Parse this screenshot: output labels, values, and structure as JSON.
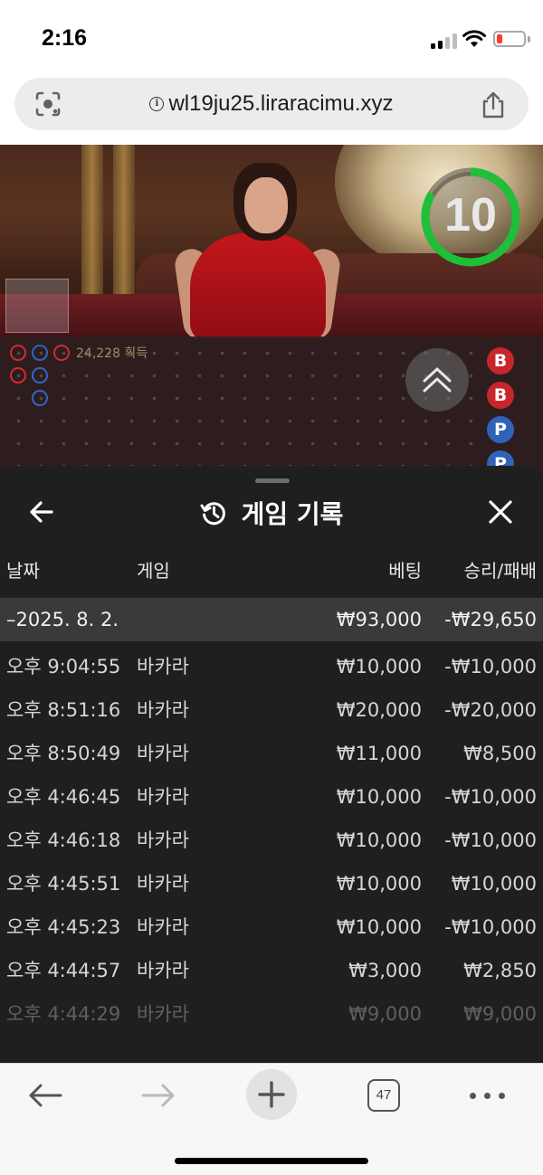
{
  "status_bar": {
    "time": "2:16"
  },
  "browser": {
    "url": "wl19ju25.liraracimu.xyz",
    "tab_count": "47"
  },
  "game": {
    "timer": "10",
    "roadmap_text": "24,228 획득",
    "side_badges": [
      "B",
      "B",
      "P",
      "P"
    ]
  },
  "history": {
    "title": "게임 기록",
    "columns": {
      "date": "날짜",
      "game": "게임",
      "bet": "베팅",
      "result": "승리/패배"
    },
    "summary": {
      "date": "–2025. 8. 2.",
      "bet": "₩93,000",
      "result": "-₩29,650"
    },
    "rows": [
      {
        "time": "오후 9:04:55",
        "game": "바카라",
        "bet": "₩10,000",
        "result": "-₩10,000"
      },
      {
        "time": "오후 8:51:16",
        "game": "바카라",
        "bet": "₩20,000",
        "result": "-₩20,000"
      },
      {
        "time": "오후 8:50:49",
        "game": "바카라",
        "bet": "₩11,000",
        "result": "₩8,500"
      },
      {
        "time": "오후 4:46:45",
        "game": "바카라",
        "bet": "₩10,000",
        "result": "-₩10,000"
      },
      {
        "time": "오후 4:46:18",
        "game": "바카라",
        "bet": "₩10,000",
        "result": "-₩10,000"
      },
      {
        "time": "오후 4:45:51",
        "game": "바카라",
        "bet": "₩10,000",
        "result": "₩10,000"
      },
      {
        "time": "오후 4:45:23",
        "game": "바카라",
        "bet": "₩10,000",
        "result": "-₩10,000"
      },
      {
        "time": "오후 4:44:57",
        "game": "바카라",
        "bet": "₩3,000",
        "result": "₩2,850"
      },
      {
        "time": "오후 4:44:29",
        "game": "바카라",
        "bet": "₩9,000",
        "result": "₩9,000"
      }
    ]
  },
  "colors": {
    "timer_ring": "#1fbf3a",
    "banker": "#c8262c",
    "player": "#2e63b8",
    "sheet_bg": "#1f1f1f",
    "summary_bg": "#3a3a3a"
  },
  "icons": {
    "url_left": "lens-icon",
    "url_info": "info-icon",
    "url_right": "share-icon",
    "sheet_back": "back-arrow-icon",
    "sheet_title": "history-icon",
    "sheet_close": "close-icon",
    "toolbar": [
      "back-arrow-icon",
      "forward-arrow-icon",
      "plus-icon",
      "tabs-icon",
      "more-icon"
    ]
  }
}
